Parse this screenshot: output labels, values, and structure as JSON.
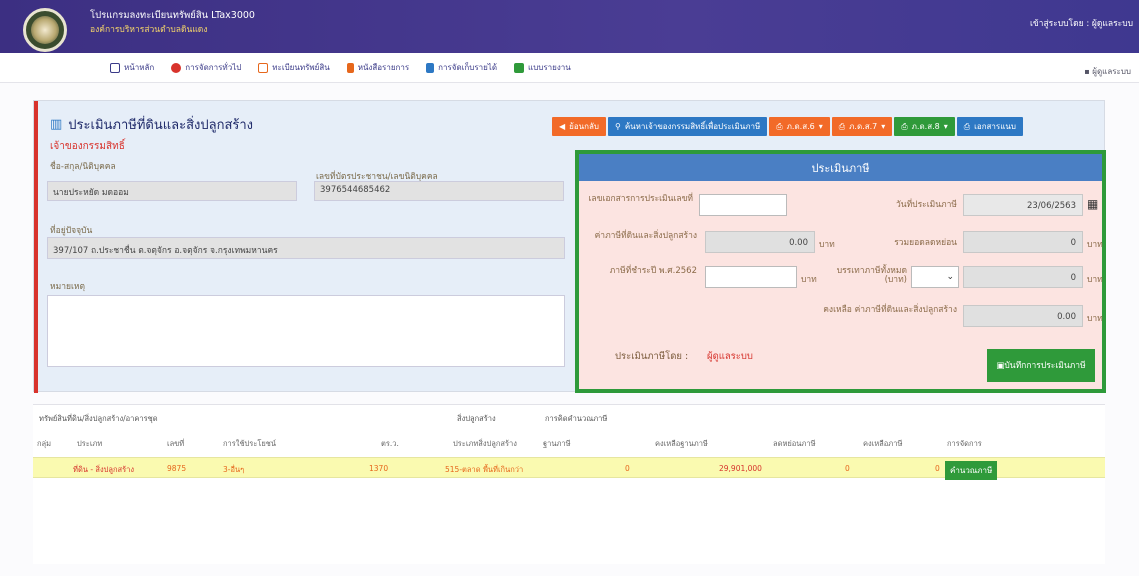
{
  "header": {
    "app_title": "โปรแกรมลงทะเบียนทรัพย์สิน LTax3000",
    "org_name": "องค์การบริหารส่วนตำบลดินแดง",
    "login_label": "เข้าสู่ระบบโดย : ผู้ดูแลระบบ"
  },
  "menu": {
    "items": [
      {
        "label": "หน้าหลัก",
        "icon": "home-icon",
        "color": "#3a3a88"
      },
      {
        "label": "การจัดการทั่วไป",
        "icon": "gear-icon",
        "color": "#d8332c"
      },
      {
        "label": "ทะเบียนทรัพย์สิน",
        "icon": "book-icon",
        "color": "#e6671c"
      },
      {
        "label": "หนังสือรายการ",
        "icon": "document-icon",
        "color": "#e6671c"
      },
      {
        "label": "การจัดเก็บรายได้",
        "icon": "calculator-icon",
        "color": "#2d78c4"
      },
      {
        "label": "แบบรายงาน",
        "icon": "table-icon",
        "color": "#2f9a3a"
      }
    ],
    "user_label": "ผู้ดูแลระบบ"
  },
  "page": {
    "title": "ประเมินภาษีที่ดินและสิ่งปลูกสร้าง",
    "owner_section": "เจ้าของกรรมสิทธิ์"
  },
  "owner": {
    "name_label": "ชื่อ-สกุล/นิติบุคคล",
    "name_value": "นายประหยัด มดออม",
    "id_label": "เลขที่บัตรประชาชน/เลขนิติบุคคล",
    "id_value": "3976544685462",
    "address_label": "ที่อยู่ปัจจุบัน",
    "address_value": "397/107 ถ.ประชาชื่น ต.จตุจักร อ.จตุจักร จ.กรุงเทพมหานคร",
    "note_label": "หมายเหตุ"
  },
  "actions": {
    "back": "ย้อนกลับ",
    "search": "ค้นหาเจ้าของกรรมสิทธิ์เพื่อประเมินภาษี",
    "pds6": "ภ.ด.ส.6",
    "pds7": "ภ.ด.ส.7",
    "pds8": "ภ.ด.ส.8",
    "summary": "เอกสารแนบ"
  },
  "tax": {
    "title": "ประเมินภาษี",
    "doc_no_label": "เลขเอกสารการประเมินเลขที่",
    "doc_no_value": "",
    "date_label": "วันที่ประเมินภาษี",
    "date_value": "23/06/2563",
    "tax_amount_label": "ค่าภาษีที่ดินและสิ่งปลูกสร้าง",
    "tax_amount_value": "0.00",
    "unit_baht": "บาท",
    "discount_label": "รวมยอดลดหย่อน",
    "discount_value": "0",
    "paid_label": "ภาษีที่ชำระปี พ.ศ.2562",
    "paid_value": "",
    "relief_label": "บรรเทาภาษีทั้งหมด (บาท)",
    "relief_value": "0",
    "remaining_label": "คงเหลือ ค่าภาษีที่ดินและสิ่งปลูกสร้าง",
    "remaining_value": "0.00",
    "assessor_label": "ประเมินภาษีโดย :",
    "assessor_value": "ผู้ดูแลระบบ",
    "save_label": "บันทึกการประเมินภาษี"
  },
  "table": {
    "group_asset": "ทรัพย์สินที่ดิน/สิ่งปลูกสร้าง/อาคารชุด",
    "group_building": "สิ่งปลูกสร้าง",
    "group_calc": "การคิดคำนวณภาษี",
    "headers": [
      "กลุ่ม",
      "ประเภท",
      "เลขที่",
      "การใช้ประโยชน์",
      "ตร.ว.",
      "ประเภทสิ่งปลูกสร้าง",
      "ฐานภาษี",
      "คงเหลือฐานภาษี",
      "ลดหย่อนภาษี",
      "คงเหลือภาษี",
      "การจัดการ"
    ],
    "rows": [
      {
        "group": "",
        "type": "ที่ดิน - สิ่งปลูกสร้าง",
        "number": "9875",
        "usage": "3-อื่นๆ",
        "area": "1370",
        "building": "515-ตลาด พื้นที่เกินกว่า",
        "tax_base": "0",
        "remaining_base": "29,901,000",
        "deduction": "0",
        "remaining_tax": "0",
        "action": "คำนวณภาษี"
      }
    ]
  }
}
